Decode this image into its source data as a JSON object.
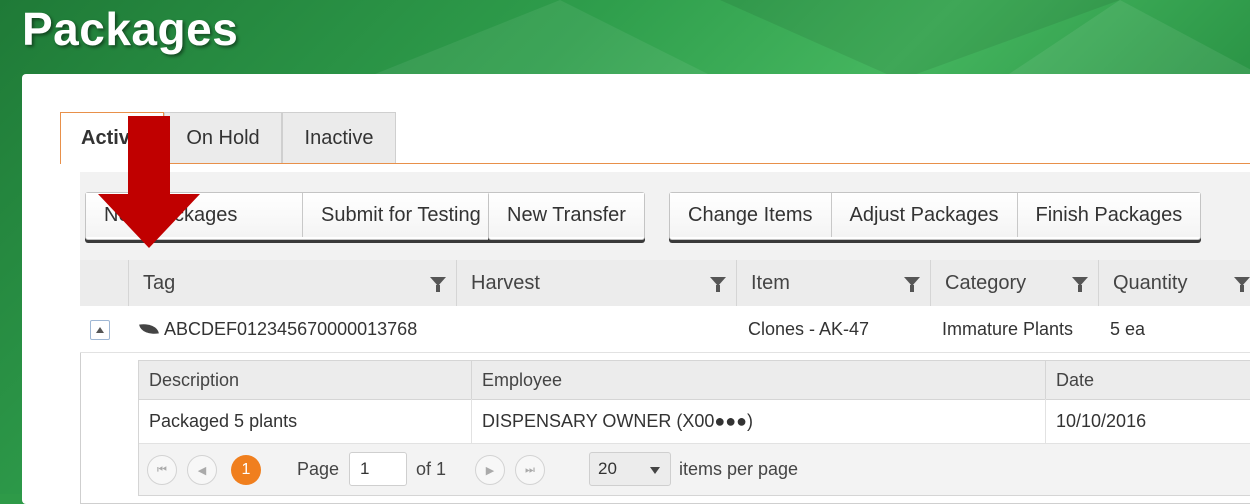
{
  "page": {
    "title": "Packages"
  },
  "tabs": [
    {
      "label": "Active"
    },
    {
      "label": "On Hold"
    },
    {
      "label": "Inactive"
    }
  ],
  "toolbar": {
    "groups": [
      [
        "New Packages",
        "Submit for Testing"
      ],
      [
        "New Transfer"
      ],
      [
        "Change Items",
        "Adjust Packages",
        "Finish Packages"
      ]
    ]
  },
  "table": {
    "columns": [
      "Tag",
      "Harvest",
      "Item",
      "Category",
      "Quantity"
    ],
    "rows": [
      {
        "tag": "ABCDEF012345670000013768",
        "harvest": "",
        "item": "Clones - AK-47",
        "category": "Immature Plants",
        "quantity": "5 ea"
      }
    ]
  },
  "detail": {
    "columns": [
      "Description",
      "Employee",
      "Date"
    ],
    "rows": [
      {
        "description": "Packaged 5 plants",
        "employee": "DISPENSARY OWNER (X00●●●)",
        "date": "10/10/2016"
      }
    ],
    "pager": {
      "current_page": "1",
      "page_label": "Page",
      "page_input": "1",
      "of_label": "of 1",
      "page_size": "20",
      "items_per_page_label": "items per page"
    }
  },
  "annotation": {
    "arrow_color": "#c00000"
  },
  "colors": {
    "accent": "#f07f1e",
    "brand_green": "#2e9a48"
  }
}
